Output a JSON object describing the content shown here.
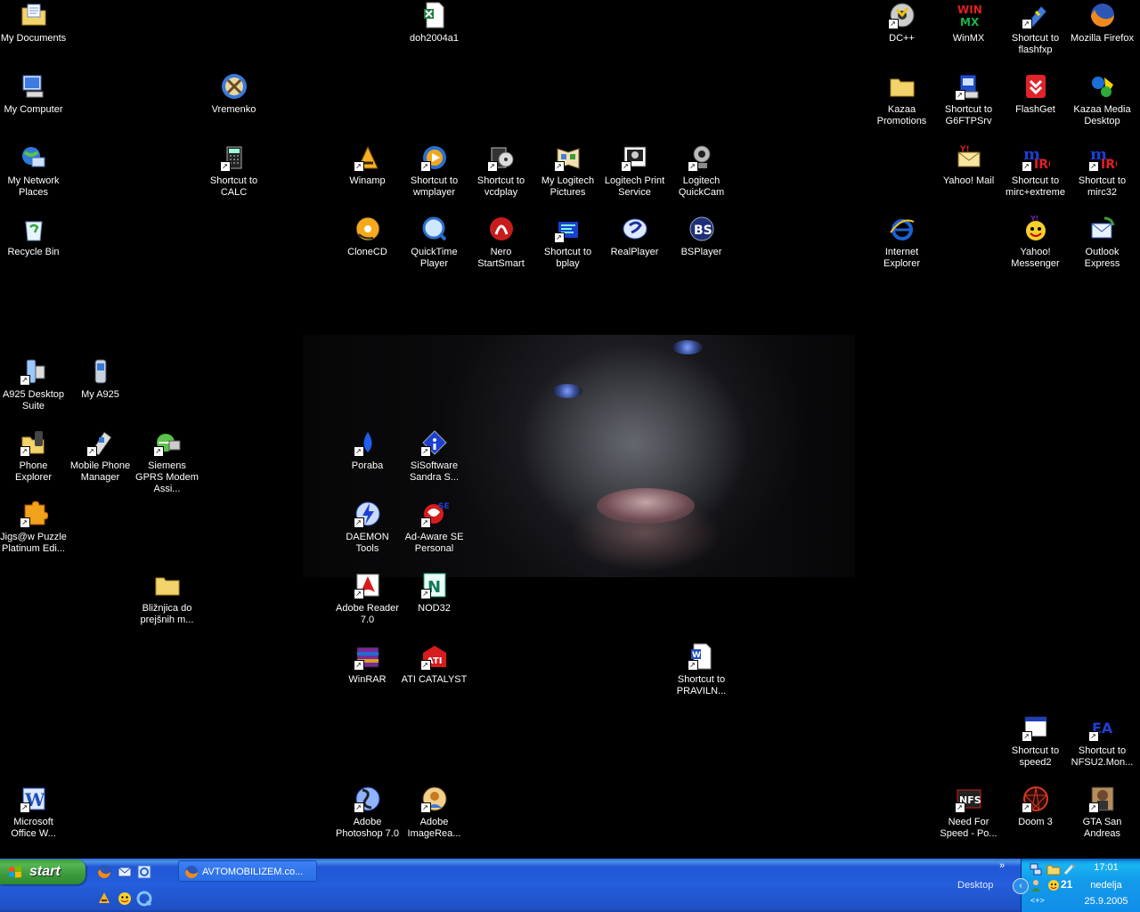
{
  "desktop_icons": [
    {
      "id": "my-documents",
      "label": "My Documents",
      "icon": "folder-documents",
      "shortcut": false
    },
    {
      "id": "doh2004a1",
      "label": "doh2004a1",
      "icon": "excel-file",
      "shortcut": false
    },
    {
      "id": "dcpp",
      "label": "DC++",
      "icon": "dcpp",
      "shortcut": true
    },
    {
      "id": "winmx",
      "label": "WinMX",
      "icon": "winmx",
      "shortcut": false
    },
    {
      "id": "flashfxp",
      "label": "Shortcut to flashfxp",
      "icon": "flashfxp",
      "shortcut": true
    },
    {
      "id": "firefox",
      "label": "Mozilla Firefox",
      "icon": "firefox",
      "shortcut": false
    },
    {
      "id": "my-computer",
      "label": "My Computer",
      "icon": "computer",
      "shortcut": false
    },
    {
      "id": "vremenko",
      "label": "Vremenko",
      "icon": "vremenko",
      "shortcut": false
    },
    {
      "id": "kazaa-promotions",
      "label": "Kazaa Promotions",
      "icon": "folder",
      "shortcut": false
    },
    {
      "id": "g6ftpsrv",
      "label": "Shortcut to G6FTPSrv",
      "icon": "ftp-server",
      "shortcut": true
    },
    {
      "id": "flashget",
      "label": "FlashGet",
      "icon": "flashget",
      "shortcut": false
    },
    {
      "id": "kazaa-desktop",
      "label": "Kazaa Media Desktop",
      "icon": "kazaa",
      "shortcut": false
    },
    {
      "id": "my-network",
      "label": "My Network Places",
      "icon": "network",
      "shortcut": false
    },
    {
      "id": "calc",
      "label": "Shortcut to CALC",
      "icon": "calculator",
      "shortcut": true
    },
    {
      "id": "winamp",
      "label": "Winamp",
      "icon": "winamp",
      "shortcut": true
    },
    {
      "id": "wmplayer",
      "label": "Shortcut to wmplayer",
      "icon": "media-player",
      "shortcut": true
    },
    {
      "id": "vcdplay",
      "label": "Shortcut to vcdplay",
      "icon": "vcdplay",
      "shortcut": true
    },
    {
      "id": "logitech-pictures",
      "label": "My Logitech Pictures",
      "icon": "logitech-pictures",
      "shortcut": true
    },
    {
      "id": "logitech-print",
      "label": "Logitech Print Service",
      "icon": "print-service",
      "shortcut": true
    },
    {
      "id": "quickcam",
      "label": "Logitech QuickCam",
      "icon": "webcam",
      "shortcut": true
    },
    {
      "id": "yahoo-mail",
      "label": "Yahoo! Mail",
      "icon": "yahoo-mail",
      "shortcut": false
    },
    {
      "id": "mirc-extreme",
      "label": "Shortcut to mirc+extreme",
      "icon": "mirc",
      "shortcut": true
    },
    {
      "id": "mirc32",
      "label": "Shortcut to mirc32",
      "icon": "mirc",
      "shortcut": true
    },
    {
      "id": "recycle-bin",
      "label": "Recycle Bin",
      "icon": "recycle-bin",
      "shortcut": false
    },
    {
      "id": "clonecd",
      "label": "CloneCD",
      "icon": "clonecd",
      "shortcut": false
    },
    {
      "id": "quicktime",
      "label": "QuickTime Player",
      "icon": "quicktime",
      "shortcut": false
    },
    {
      "id": "nero",
      "label": "Nero StartSmart",
      "icon": "nero",
      "shortcut": false
    },
    {
      "id": "bplay",
      "label": "Shortcut to bplay",
      "icon": "bplay",
      "shortcut": true
    },
    {
      "id": "realplayer",
      "label": "RealPlayer",
      "icon": "realplayer",
      "shortcut": false
    },
    {
      "id": "bsplayer",
      "label": "BSPlayer",
      "icon": "bsplayer",
      "shortcut": false
    },
    {
      "id": "ie",
      "label": "Internet Explorer",
      "icon": "internet-explorer",
      "shortcut": false
    },
    {
      "id": "yahoo-messenger",
      "label": "Yahoo! Messenger",
      "icon": "yahoo-messenger",
      "shortcut": false
    },
    {
      "id": "outlook-express",
      "label": "Outlook Express",
      "icon": "outlook-express",
      "shortcut": false
    },
    {
      "id": "a925-suite",
      "label": "A925 Desktop Suite",
      "icon": "phone-suite",
      "shortcut": true
    },
    {
      "id": "my-a925",
      "label": "My A925",
      "icon": "phone",
      "shortcut": false
    },
    {
      "id": "phone-explorer",
      "label": "Phone Explorer",
      "icon": "phone-explorer",
      "shortcut": true
    },
    {
      "id": "mobile-phone-manager",
      "label": "Mobile Phone Manager",
      "icon": "phone-manager",
      "shortcut": true
    },
    {
      "id": "siemens-gprs",
      "label": "Siemens GPRS Modem Assi...",
      "icon": "modem",
      "shortcut": true
    },
    {
      "id": "poraba",
      "label": "Poraba",
      "icon": "drop",
      "shortcut": true
    },
    {
      "id": "sisoftware",
      "label": "SiSoftware Sandra S...",
      "icon": "sandra",
      "shortcut": true
    },
    {
      "id": "jigsaw",
      "label": "Jigs@w Puzzle Platinum Edi...",
      "icon": "puzzle",
      "shortcut": true
    },
    {
      "id": "daemon",
      "label": "DAEMON Tools",
      "icon": "daemon",
      "shortcut": true
    },
    {
      "id": "adaware",
      "label": "Ad-Aware SE Personal",
      "icon": "adaware",
      "shortcut": true
    },
    {
      "id": "bliznjica",
      "label": "Bližnjica do prejšnih m...",
      "icon": "folder",
      "shortcut": false
    },
    {
      "id": "acrobat",
      "label": "Adobe Reader 7.0",
      "icon": "adobe-reader",
      "shortcut": true
    },
    {
      "id": "nod32",
      "label": "NOD32",
      "icon": "nod32",
      "shortcut": true
    },
    {
      "id": "winrar",
      "label": "WinRAR",
      "icon": "winrar",
      "shortcut": true
    },
    {
      "id": "ati",
      "label": "ATI CATALYST",
      "icon": "ati",
      "shortcut": true
    },
    {
      "id": "pravila",
      "label": "Shortcut to PRAVILN...",
      "icon": "word-file",
      "shortcut": true
    },
    {
      "id": "speed2",
      "label": "Shortcut to speed2",
      "icon": "window-app",
      "shortcut": true
    },
    {
      "id": "nfsu2",
      "label": "Shortcut to NFSU2.Mon...",
      "icon": "ea",
      "shortcut": true
    },
    {
      "id": "msoffice",
      "label": "Microsoft Office W...",
      "icon": "word",
      "shortcut": true
    },
    {
      "id": "photoshop",
      "label": "Adobe Photoshop 7.0",
      "icon": "photoshop",
      "shortcut": true
    },
    {
      "id": "imageready",
      "label": "Adobe ImageRea...",
      "icon": "imageready",
      "shortcut": true
    },
    {
      "id": "nfs-po",
      "label": "Need For Speed - Po...",
      "icon": "nfs",
      "shortcut": true
    },
    {
      "id": "doom3",
      "label": "Doom 3",
      "icon": "doom",
      "shortcut": true
    },
    {
      "id": "gta-sa",
      "label": "GTA San Andreas",
      "icon": "gta",
      "shortcut": true
    }
  ],
  "taskbar": {
    "start_label": "start",
    "quick_launch": [
      "firefox-icon",
      "outlook-icon",
      "ie-icon",
      "winamp-icon",
      "messenger-icon",
      "quicktime-icon"
    ],
    "task_item_label": "AVTOMOBILIZEM.co...",
    "desktop_toolbar_label": "Desktop",
    "chevron": "»"
  },
  "tray": {
    "collapse": "‹",
    "temperature": "21",
    "arrows": "<+>",
    "time": "17:01",
    "day": "nedelja",
    "date": "25.9.2005"
  },
  "colors": {
    "taskbar": "#245edb",
    "start": "#3c9b3c",
    "tray": "#139beb"
  }
}
